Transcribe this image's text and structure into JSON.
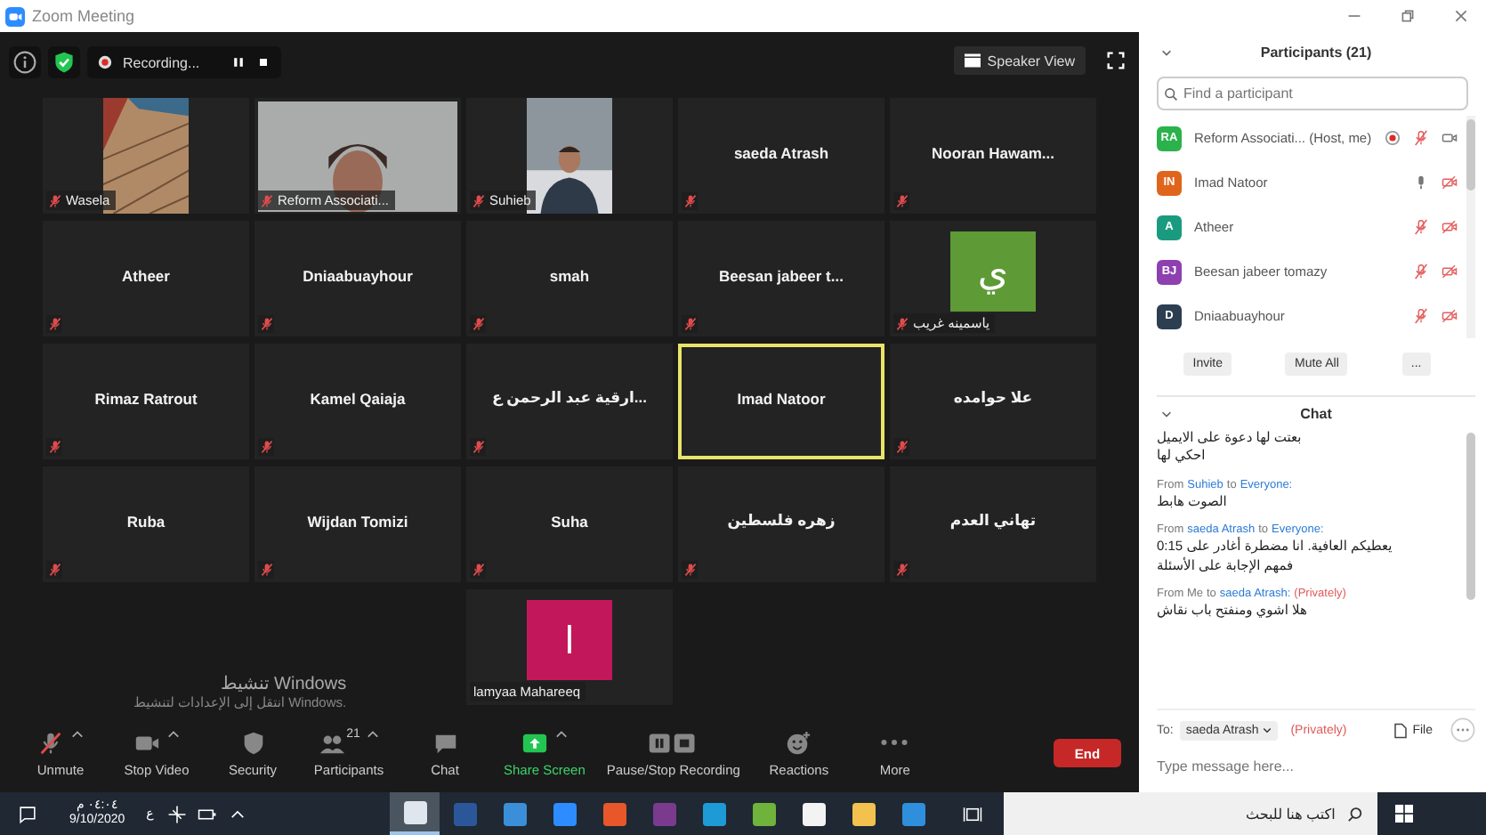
{
  "window": {
    "title": "Zoom Meeting"
  },
  "top_bar": {
    "recording_label": "Recording...",
    "view_button": "Speaker View"
  },
  "grid": [
    [
      {
        "name": "Wasela",
        "kind": "video",
        "portrait": true,
        "muted": true,
        "speaking": false
      },
      {
        "name": "Reform Associati...",
        "kind": "video",
        "portrait": false,
        "muted": true,
        "speaking": false
      },
      {
        "name": "Suhieb",
        "kind": "video",
        "portrait": true,
        "muted": true,
        "speaking": false
      },
      {
        "name": "saeda Atrash",
        "kind": "name",
        "muted": true,
        "speaking": false
      },
      {
        "name": "Nooran  Hawam...",
        "kind": "name",
        "muted": true,
        "speaking": false
      }
    ],
    [
      {
        "name": "Atheer",
        "kind": "name",
        "muted": true,
        "speaking": false
      },
      {
        "name": "Dniaabuayhour",
        "kind": "name",
        "muted": true,
        "speaking": false
      },
      {
        "name": "smah",
        "kind": "name",
        "muted": true,
        "speaking": false
      },
      {
        "name": "Beesan jabeer t...",
        "kind": "name",
        "muted": true,
        "speaking": false
      },
      {
        "name": "ياسمينه غريب",
        "kind": "avatar",
        "letter": "ي",
        "color": "#5e9a35",
        "muted": true,
        "speaking": false
      }
    ],
    [
      {
        "name": "Rimaz Ratrout",
        "kind": "name",
        "muted": true,
        "speaking": false
      },
      {
        "name": "Kamel Qaiaja",
        "kind": "name",
        "muted": true,
        "speaking": false
      },
      {
        "name": "ارقية عبد الرحمن ع...",
        "kind": "name",
        "muted": true,
        "speaking": false
      },
      {
        "name": "Imad Natoor",
        "kind": "name",
        "muted": false,
        "speaking": true
      },
      {
        "name": "علا حوامده",
        "kind": "name",
        "muted": true,
        "speaking": false
      }
    ],
    [
      {
        "name": "Ruba",
        "kind": "name",
        "muted": true,
        "speaking": false
      },
      {
        "name": "Wijdan Tomizi",
        "kind": "name",
        "muted": true,
        "speaking": false
      },
      {
        "name": "Suha",
        "kind": "name",
        "muted": true,
        "speaking": false
      },
      {
        "name": "زهره فلسطين",
        "kind": "name",
        "muted": true,
        "speaking": false
      },
      {
        "name": "تهاني العدم",
        "kind": "name",
        "muted": true,
        "speaking": false
      }
    ],
    [
      {
        "name": "lamyaa Mahareeq",
        "kind": "avatar",
        "letter": "l",
        "color": "#c2185b",
        "muted": false,
        "speaking": false
      }
    ]
  ],
  "windows_notice": [
    "تنشيط Windows",
    "انتقل إلى الإعدادات لتنشيط Windows."
  ],
  "toolbar": [
    {
      "kind": "mic",
      "label": "Unmute",
      "menu": true
    },
    {
      "kind": "video",
      "label": "Stop Video",
      "menu": true
    },
    {
      "kind": "security",
      "label": "Security",
      "menu": false
    },
    {
      "kind": "participants",
      "label": "Participants",
      "count": "21",
      "menu": true
    },
    {
      "kind": "chat",
      "label": "Chat",
      "menu": false
    },
    {
      "kind": "share",
      "label": "Share Screen",
      "menu": true
    },
    {
      "kind": "record",
      "label": "Pause/Stop Recording",
      "menu": false
    },
    {
      "kind": "reactions",
      "label": "Reactions",
      "menu": false
    },
    {
      "kind": "more",
      "label": "More",
      "menu": false
    }
  ],
  "end_button": "End",
  "participants_panel": {
    "title": "Participants (21)",
    "search": {
      "placeholder": "Find a participant"
    },
    "people": [
      {
        "initials": "RA",
        "color": "#2bb24c",
        "name": "Reform Associati... (Host, me)",
        "recording": true,
        "muted": true,
        "video_on": true
      },
      {
        "initials": "IN",
        "color": "#e0651c",
        "name": "Imad Natoor",
        "recording": false,
        "muted": false,
        "video_on": false
      },
      {
        "initials": "A",
        "color": "#1a9b7f",
        "name": "Atheer",
        "recording": false,
        "muted": true,
        "video_on": false
      },
      {
        "initials": "BJ",
        "color": "#8e3fb0",
        "name": "Beesan jabeer tomazy",
        "recording": false,
        "muted": true,
        "video_on": false
      },
      {
        "initials": "D",
        "color": "#2c3e50",
        "name": "Dniaabuayhour",
        "recording": false,
        "muted": true,
        "video_on": false
      }
    ],
    "buttons": [
      "Invite",
      "Mute All",
      "..."
    ]
  },
  "chat": {
    "title": "Chat",
    "messages": [
      {
        "lines": [
          "بعتت لها دعوة على الايميل",
          "احكي لها"
        ]
      },
      {
        "from_label": "From",
        "sender": "Suhieb",
        "to_label": "to",
        "recipient": "Everyone:",
        "lines": [
          "الصوت هابط"
        ]
      },
      {
        "from_label": "From",
        "sender": "saeda Atrash",
        "to_label": "to",
        "recipient": "Everyone:",
        "lines": [
          "يعطيكم العافية. انا مضطرة أغادر على 0:15",
          "فمهم الإجابة على الأسئلة"
        ]
      },
      {
        "from_label": "From Me",
        "to_label": "to",
        "recipient": "saeda Atrash:",
        "privately": "(Privately)",
        "lines": [
          "هلا اشوي ومنفتح باب نقاش"
        ]
      }
    ],
    "to_label": "To:",
    "recipient_select": "saeda Atrash",
    "privately": "(Privately)",
    "file_button": "File",
    "input": {
      "placeholder": "Type message here..."
    }
  },
  "taskbar": {
    "time": "٠٤:٠٤ م",
    "date": "9/10/2020",
    "language": "ع",
    "search": {
      "placeholder": "اكتب هنا للبحث"
    },
    "apps": [
      {
        "color": "#dfe6ee",
        "selected": true
      },
      {
        "color": "#2b579a",
        "selected": false
      },
      {
        "color": "#3a8fd8",
        "selected": false
      },
      {
        "color": "#2d8cff",
        "selected": false
      },
      {
        "color": "#e8572a",
        "selected": false
      },
      {
        "color": "#7a3b8f",
        "selected": false
      },
      {
        "color": "#1e9bd7",
        "selected": false
      },
      {
        "color": "#6fb23c",
        "selected": false
      },
      {
        "color": "#f3f3f3",
        "selected": false
      },
      {
        "color": "#f2c14e",
        "selected": false
      },
      {
        "color": "#2f8fdd",
        "selected": false
      }
    ]
  }
}
